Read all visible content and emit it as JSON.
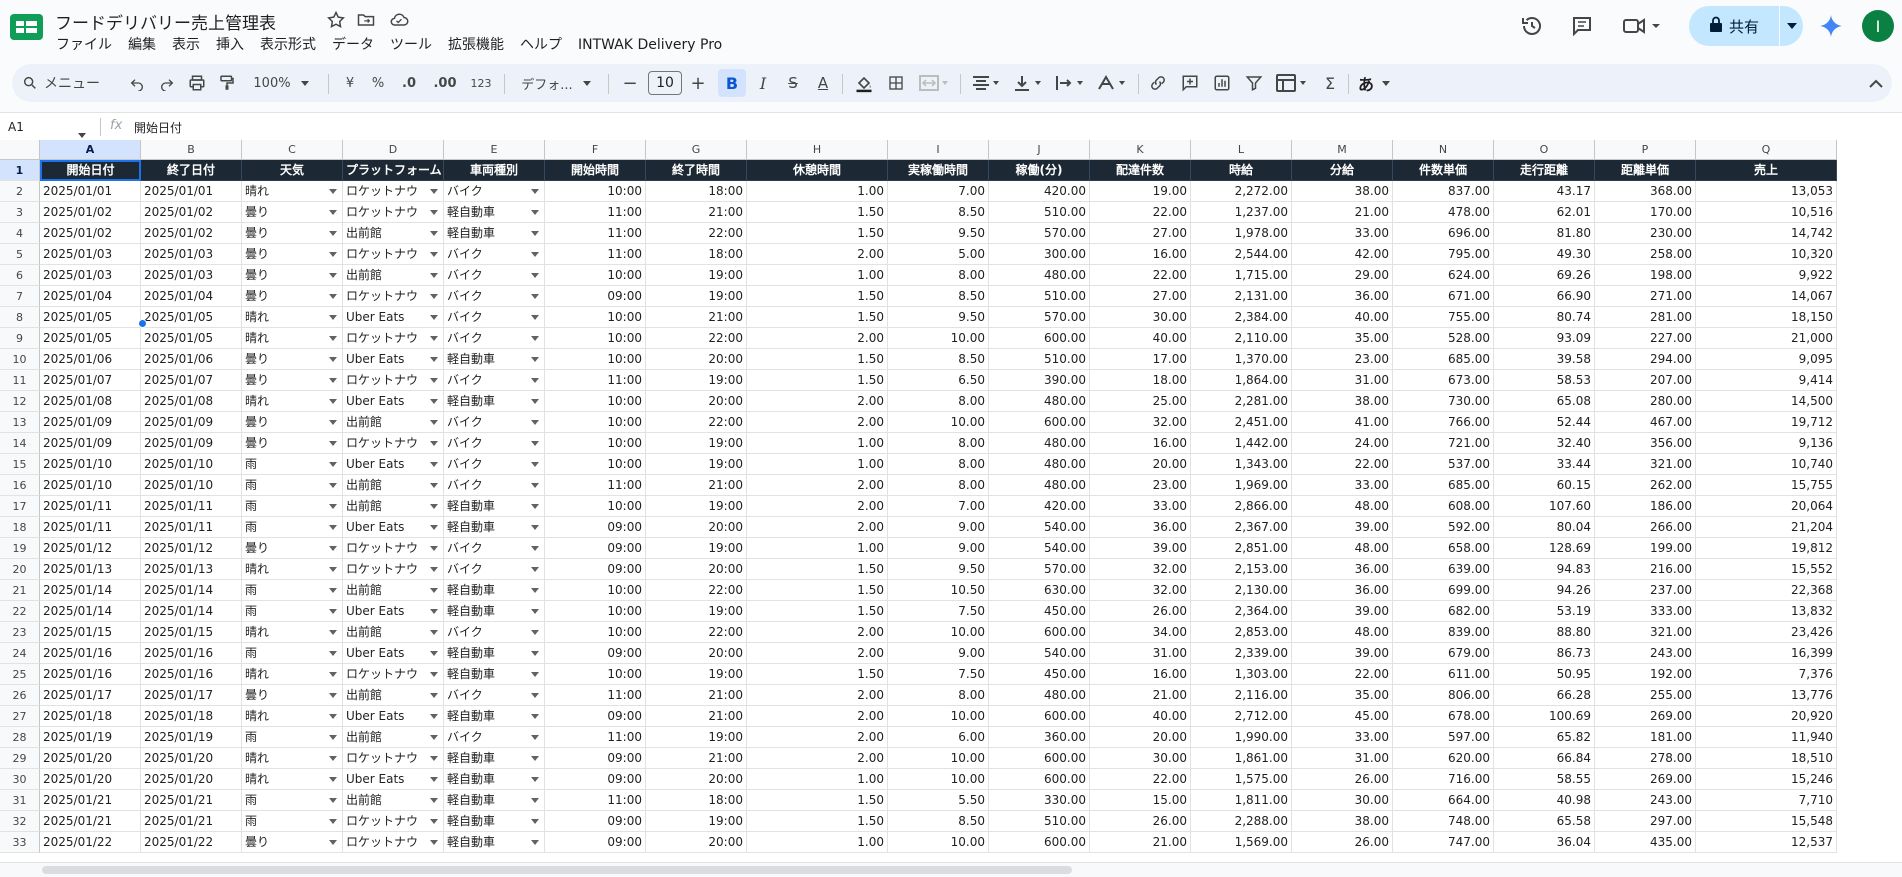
{
  "header": {
    "title": "フードデリバリー売上管理表",
    "menu": [
      "ファイル",
      "編集",
      "表示",
      "挿入",
      "表示形式",
      "データ",
      "ツール",
      "拡張機能",
      "ヘルプ",
      "INTWAK Delivery Pro"
    ],
    "share_label": "共有",
    "avatar_letter": "I"
  },
  "toolbar": {
    "search_label": "メニュー",
    "zoom": "100%",
    "currency": "¥",
    "percent": "%",
    "dec_decrease": ".0",
    "dec_increase": ".00",
    "format_123": "123",
    "font_name": "デフォ...",
    "font_size": "10",
    "bold": "B",
    "italic": "I",
    "strike": "S",
    "text_color": "A",
    "sigma": "Σ",
    "input_tools": "あ"
  },
  "formula_bar": {
    "cell_ref": "A1",
    "fx": "fx",
    "value": "開始日付"
  },
  "sheet": {
    "columns": [
      "A",
      "B",
      "C",
      "D",
      "E",
      "F",
      "G",
      "H",
      "I",
      "J",
      "K",
      "L",
      "M",
      "N",
      "O",
      "P",
      "Q"
    ],
    "selected_column": "A",
    "selected_row": 1,
    "headers": [
      "開始日付",
      "終了日付",
      "天気",
      "プラットフォーム",
      "車両種別",
      "開始時間",
      "終了時間",
      "休憩時間",
      "実稼働時間",
      "稼働(分)",
      "配達件数",
      "時給",
      "分給",
      "件数単価",
      "走行距離",
      "距離単価",
      "売上"
    ],
    "rows": [
      [
        "2025/01/01",
        "2025/01/01",
        "晴れ",
        "ロケットナウ",
        "バイク",
        "10:00",
        "18:00",
        "1.00",
        "7.00",
        "420.00",
        "19.00",
        "2,272.00",
        "38.00",
        "837.00",
        "43.17",
        "368.00",
        "13,053"
      ],
      [
        "2025/01/02",
        "2025/01/02",
        "曇り",
        "ロケットナウ",
        "軽自動車",
        "11:00",
        "21:00",
        "1.50",
        "8.50",
        "510.00",
        "22.00",
        "1,237.00",
        "21.00",
        "478.00",
        "62.01",
        "170.00",
        "10,516"
      ],
      [
        "2025/01/02",
        "2025/01/02",
        "曇り",
        "出前館",
        "軽自動車",
        "11:00",
        "22:00",
        "1.50",
        "9.50",
        "570.00",
        "27.00",
        "1,978.00",
        "33.00",
        "696.00",
        "81.80",
        "230.00",
        "14,742"
      ],
      [
        "2025/01/03",
        "2025/01/03",
        "曇り",
        "ロケットナウ",
        "バイク",
        "11:00",
        "18:00",
        "2.00",
        "5.00",
        "300.00",
        "16.00",
        "2,544.00",
        "42.00",
        "795.00",
        "49.30",
        "258.00",
        "10,320"
      ],
      [
        "2025/01/03",
        "2025/01/03",
        "曇り",
        "出前館",
        "バイク",
        "10:00",
        "19:00",
        "1.00",
        "8.00",
        "480.00",
        "22.00",
        "1,715.00",
        "29.00",
        "624.00",
        "69.26",
        "198.00",
        "9,922"
      ],
      [
        "2025/01/04",
        "2025/01/04",
        "曇り",
        "ロケットナウ",
        "バイク",
        "09:00",
        "19:00",
        "1.50",
        "8.50",
        "510.00",
        "27.00",
        "2,131.00",
        "36.00",
        "671.00",
        "66.90",
        "271.00",
        "14,067"
      ],
      [
        "2025/01/05",
        "2025/01/05",
        "晴れ",
        "Uber Eats",
        "バイク",
        "10:00",
        "21:00",
        "1.50",
        "9.50",
        "570.00",
        "30.00",
        "2,384.00",
        "40.00",
        "755.00",
        "80.74",
        "281.00",
        "18,150"
      ],
      [
        "2025/01/05",
        "2025/01/05",
        "晴れ",
        "ロケットナウ",
        "バイク",
        "10:00",
        "22:00",
        "2.00",
        "10.00",
        "600.00",
        "40.00",
        "2,110.00",
        "35.00",
        "528.00",
        "93.09",
        "227.00",
        "21,000"
      ],
      [
        "2025/01/06",
        "2025/01/06",
        "曇り",
        "Uber Eats",
        "軽自動車",
        "10:00",
        "20:00",
        "1.50",
        "8.50",
        "510.00",
        "17.00",
        "1,370.00",
        "23.00",
        "685.00",
        "39.58",
        "294.00",
        "9,095"
      ],
      [
        "2025/01/07",
        "2025/01/07",
        "曇り",
        "ロケットナウ",
        "バイク",
        "11:00",
        "19:00",
        "1.50",
        "6.50",
        "390.00",
        "18.00",
        "1,864.00",
        "31.00",
        "673.00",
        "58.53",
        "207.00",
        "9,414"
      ],
      [
        "2025/01/08",
        "2025/01/08",
        "晴れ",
        "Uber Eats",
        "軽自動車",
        "10:00",
        "20:00",
        "2.00",
        "8.00",
        "480.00",
        "25.00",
        "2,281.00",
        "38.00",
        "730.00",
        "65.08",
        "280.00",
        "14,500"
      ],
      [
        "2025/01/09",
        "2025/01/09",
        "曇り",
        "出前館",
        "バイク",
        "10:00",
        "22:00",
        "2.00",
        "10.00",
        "600.00",
        "32.00",
        "2,451.00",
        "41.00",
        "766.00",
        "52.44",
        "467.00",
        "19,712"
      ],
      [
        "2025/01/09",
        "2025/01/09",
        "曇り",
        "ロケットナウ",
        "バイク",
        "10:00",
        "19:00",
        "1.00",
        "8.00",
        "480.00",
        "16.00",
        "1,442.00",
        "24.00",
        "721.00",
        "32.40",
        "356.00",
        "9,136"
      ],
      [
        "2025/01/10",
        "2025/01/10",
        "雨",
        "Uber Eats",
        "バイク",
        "10:00",
        "19:00",
        "1.00",
        "8.00",
        "480.00",
        "20.00",
        "1,343.00",
        "22.00",
        "537.00",
        "33.44",
        "321.00",
        "10,740"
      ],
      [
        "2025/01/10",
        "2025/01/10",
        "雨",
        "出前館",
        "バイク",
        "11:00",
        "21:00",
        "2.00",
        "8.00",
        "480.00",
        "23.00",
        "1,969.00",
        "33.00",
        "685.00",
        "60.15",
        "262.00",
        "15,755"
      ],
      [
        "2025/01/11",
        "2025/01/11",
        "雨",
        "出前館",
        "軽自動車",
        "10:00",
        "19:00",
        "2.00",
        "7.00",
        "420.00",
        "33.00",
        "2,866.00",
        "48.00",
        "608.00",
        "107.60",
        "186.00",
        "20,064"
      ],
      [
        "2025/01/11",
        "2025/01/11",
        "雨",
        "Uber Eats",
        "軽自動車",
        "09:00",
        "20:00",
        "2.00",
        "9.00",
        "540.00",
        "36.00",
        "2,367.00",
        "39.00",
        "592.00",
        "80.04",
        "266.00",
        "21,204"
      ],
      [
        "2025/01/12",
        "2025/01/12",
        "曇り",
        "ロケットナウ",
        "バイク",
        "09:00",
        "19:00",
        "1.00",
        "9.00",
        "540.00",
        "39.00",
        "2,851.00",
        "48.00",
        "658.00",
        "128.69",
        "199.00",
        "19,812"
      ],
      [
        "2025/01/13",
        "2025/01/13",
        "晴れ",
        "ロケットナウ",
        "バイク",
        "09:00",
        "20:00",
        "1.50",
        "9.50",
        "570.00",
        "32.00",
        "2,153.00",
        "36.00",
        "639.00",
        "94.83",
        "216.00",
        "15,552"
      ],
      [
        "2025/01/14",
        "2025/01/14",
        "雨",
        "出前館",
        "軽自動車",
        "10:00",
        "22:00",
        "1.50",
        "10.50",
        "630.00",
        "32.00",
        "2,130.00",
        "36.00",
        "699.00",
        "94.26",
        "237.00",
        "22,368"
      ],
      [
        "2025/01/14",
        "2025/01/14",
        "雨",
        "Uber Eats",
        "軽自動車",
        "10:00",
        "19:00",
        "1.50",
        "7.50",
        "450.00",
        "26.00",
        "2,364.00",
        "39.00",
        "682.00",
        "53.19",
        "333.00",
        "13,832"
      ],
      [
        "2025/01/15",
        "2025/01/15",
        "晴れ",
        "出前館",
        "バイク",
        "10:00",
        "22:00",
        "2.00",
        "10.00",
        "600.00",
        "34.00",
        "2,853.00",
        "48.00",
        "839.00",
        "88.80",
        "321.00",
        "23,426"
      ],
      [
        "2025/01/16",
        "2025/01/16",
        "雨",
        "Uber Eats",
        "軽自動車",
        "09:00",
        "20:00",
        "2.00",
        "9.00",
        "540.00",
        "31.00",
        "2,339.00",
        "39.00",
        "679.00",
        "86.73",
        "243.00",
        "16,399"
      ],
      [
        "2025/01/16",
        "2025/01/16",
        "晴れ",
        "ロケットナウ",
        "軽自動車",
        "10:00",
        "19:00",
        "1.50",
        "7.50",
        "450.00",
        "16.00",
        "1,303.00",
        "22.00",
        "611.00",
        "50.95",
        "192.00",
        "7,376"
      ],
      [
        "2025/01/17",
        "2025/01/17",
        "曇り",
        "出前館",
        "バイク",
        "11:00",
        "21:00",
        "2.00",
        "8.00",
        "480.00",
        "21.00",
        "2,116.00",
        "35.00",
        "806.00",
        "66.28",
        "255.00",
        "13,776"
      ],
      [
        "2025/01/18",
        "2025/01/18",
        "晴れ",
        "Uber Eats",
        "軽自動車",
        "09:00",
        "21:00",
        "2.00",
        "10.00",
        "600.00",
        "40.00",
        "2,712.00",
        "45.00",
        "678.00",
        "100.69",
        "269.00",
        "20,920"
      ],
      [
        "2025/01/19",
        "2025/01/19",
        "雨",
        "出前館",
        "バイク",
        "11:00",
        "19:00",
        "2.00",
        "6.00",
        "360.00",
        "20.00",
        "1,990.00",
        "33.00",
        "597.00",
        "65.82",
        "181.00",
        "11,940"
      ],
      [
        "2025/01/20",
        "2025/01/20",
        "晴れ",
        "ロケットナウ",
        "軽自動車",
        "09:00",
        "21:00",
        "2.00",
        "10.00",
        "600.00",
        "30.00",
        "1,861.00",
        "31.00",
        "620.00",
        "66.84",
        "278.00",
        "18,510"
      ],
      [
        "2025/01/20",
        "2025/01/20",
        "晴れ",
        "Uber Eats",
        "軽自動車",
        "09:00",
        "20:00",
        "1.00",
        "10.00",
        "600.00",
        "22.00",
        "1,575.00",
        "26.00",
        "716.00",
        "58.55",
        "269.00",
        "15,246"
      ],
      [
        "2025/01/21",
        "2025/01/21",
        "雨",
        "出前館",
        "軽自動車",
        "11:00",
        "18:00",
        "1.50",
        "5.50",
        "330.00",
        "15.00",
        "1,811.00",
        "30.00",
        "664.00",
        "40.98",
        "243.00",
        "7,710"
      ],
      [
        "2025/01/21",
        "2025/01/21",
        "雨",
        "ロケットナウ",
        "軽自動車",
        "09:00",
        "19:00",
        "1.50",
        "8.50",
        "510.00",
        "26.00",
        "2,288.00",
        "38.00",
        "748.00",
        "65.58",
        "297.00",
        "15,548"
      ],
      [
        "2025/01/22",
        "2025/01/22",
        "曇り",
        "ロケットナウ",
        "軽自動車",
        "09:00",
        "20:00",
        "1.00",
        "10.00",
        "600.00",
        "21.00",
        "1,569.00",
        "26.00",
        "747.00",
        "36.04",
        "435.00",
        "12,537"
      ]
    ]
  }
}
